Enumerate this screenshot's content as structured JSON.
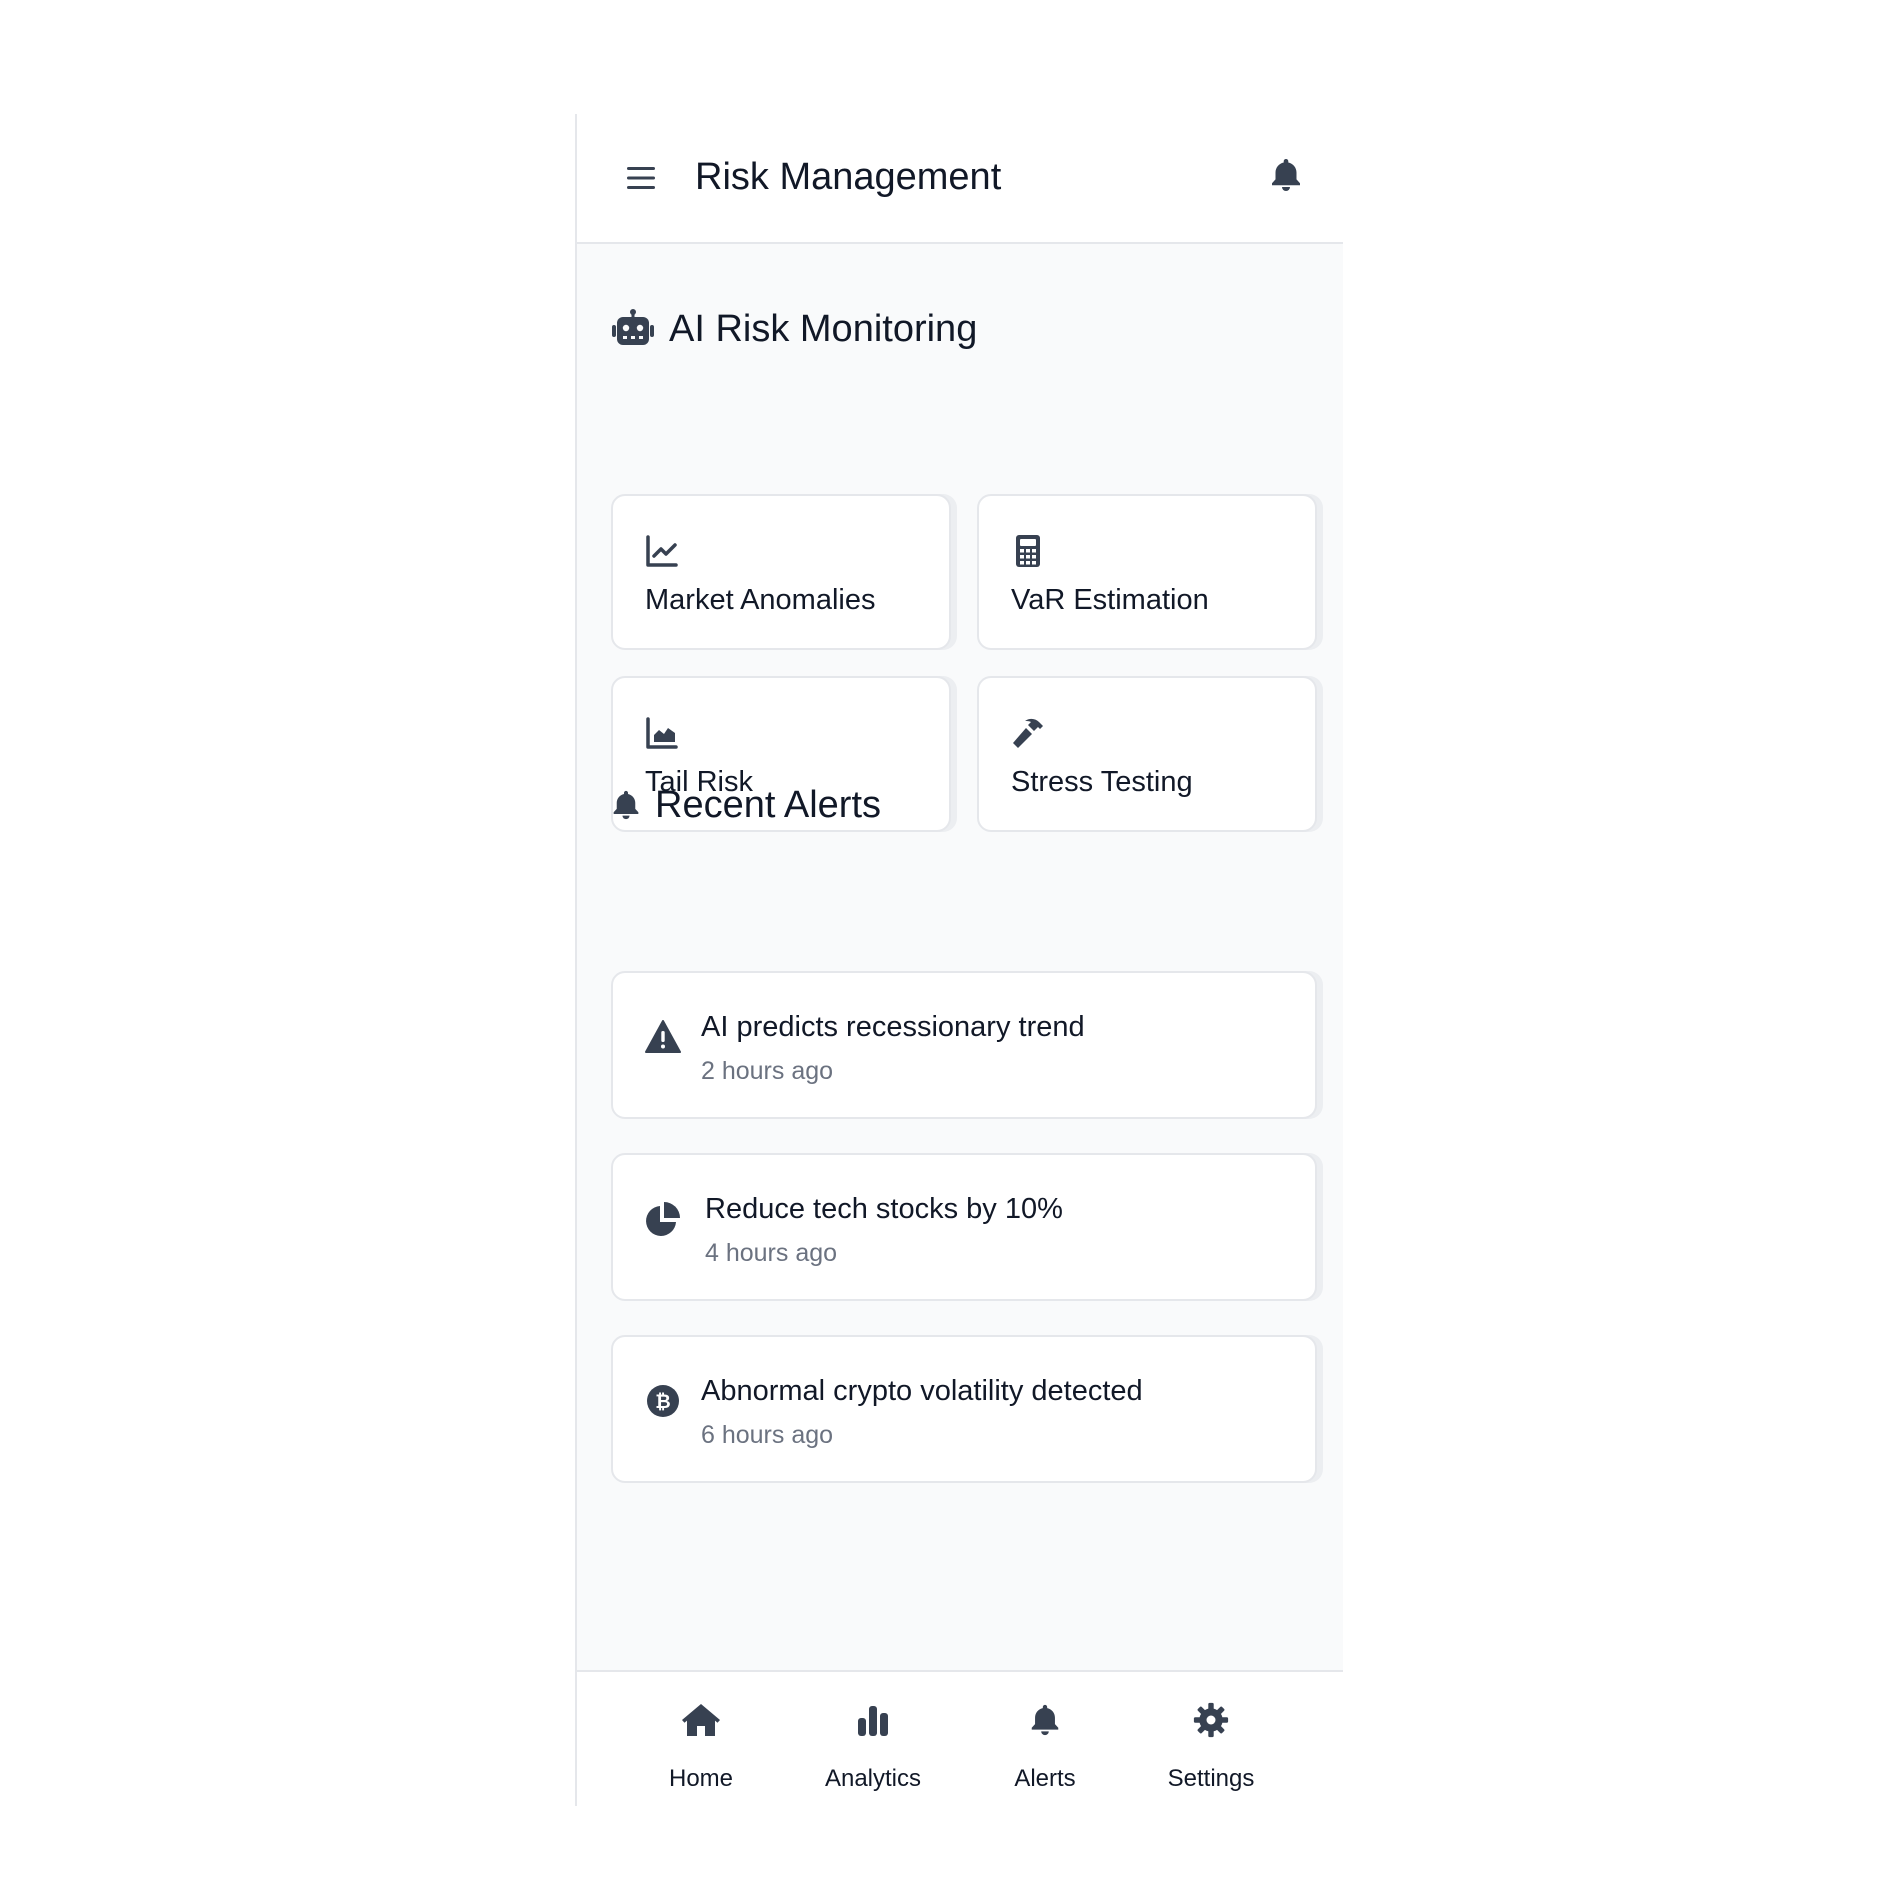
{
  "header": {
    "title": "Risk Management",
    "menu_icon": "hamburger-menu-icon",
    "notification_icon": "bell-icon"
  },
  "monitoring": {
    "title": "AI Risk Monitoring",
    "icon": "robot-icon",
    "cards": [
      {
        "label": "Market Anomalies",
        "icon": "line-chart-icon"
      },
      {
        "label": "VaR Estimation",
        "icon": "calculator-icon"
      },
      {
        "label": "Tail Risk",
        "icon": "area-chart-icon"
      },
      {
        "label": "Stress Testing",
        "icon": "hammer-icon"
      }
    ]
  },
  "alerts": {
    "title": "Recent Alerts",
    "icon": "bell-icon",
    "items": [
      {
        "title": "AI predicts recessionary trend",
        "time": "2 hours ago",
        "icon": "warning-triangle-icon"
      },
      {
        "title": "Reduce tech stocks by 10%",
        "time": "4 hours ago",
        "icon": "pie-chart-icon"
      },
      {
        "title": "Abnormal crypto volatility detected",
        "time": "6 hours ago",
        "icon": "bitcoin-icon"
      }
    ]
  },
  "nav": {
    "items": [
      {
        "label": "Home",
        "icon": "home-icon"
      },
      {
        "label": "Analytics",
        "icon": "bar-chart-icon"
      },
      {
        "label": "Alerts",
        "icon": "bell-icon"
      },
      {
        "label": "Settings",
        "icon": "gear-icon"
      }
    ]
  },
  "colors": {
    "icon": "#374151",
    "text": "#111827",
    "muted_text": "#6b7280",
    "content_background": "#f9fafb",
    "border": "#e5e7eb"
  }
}
